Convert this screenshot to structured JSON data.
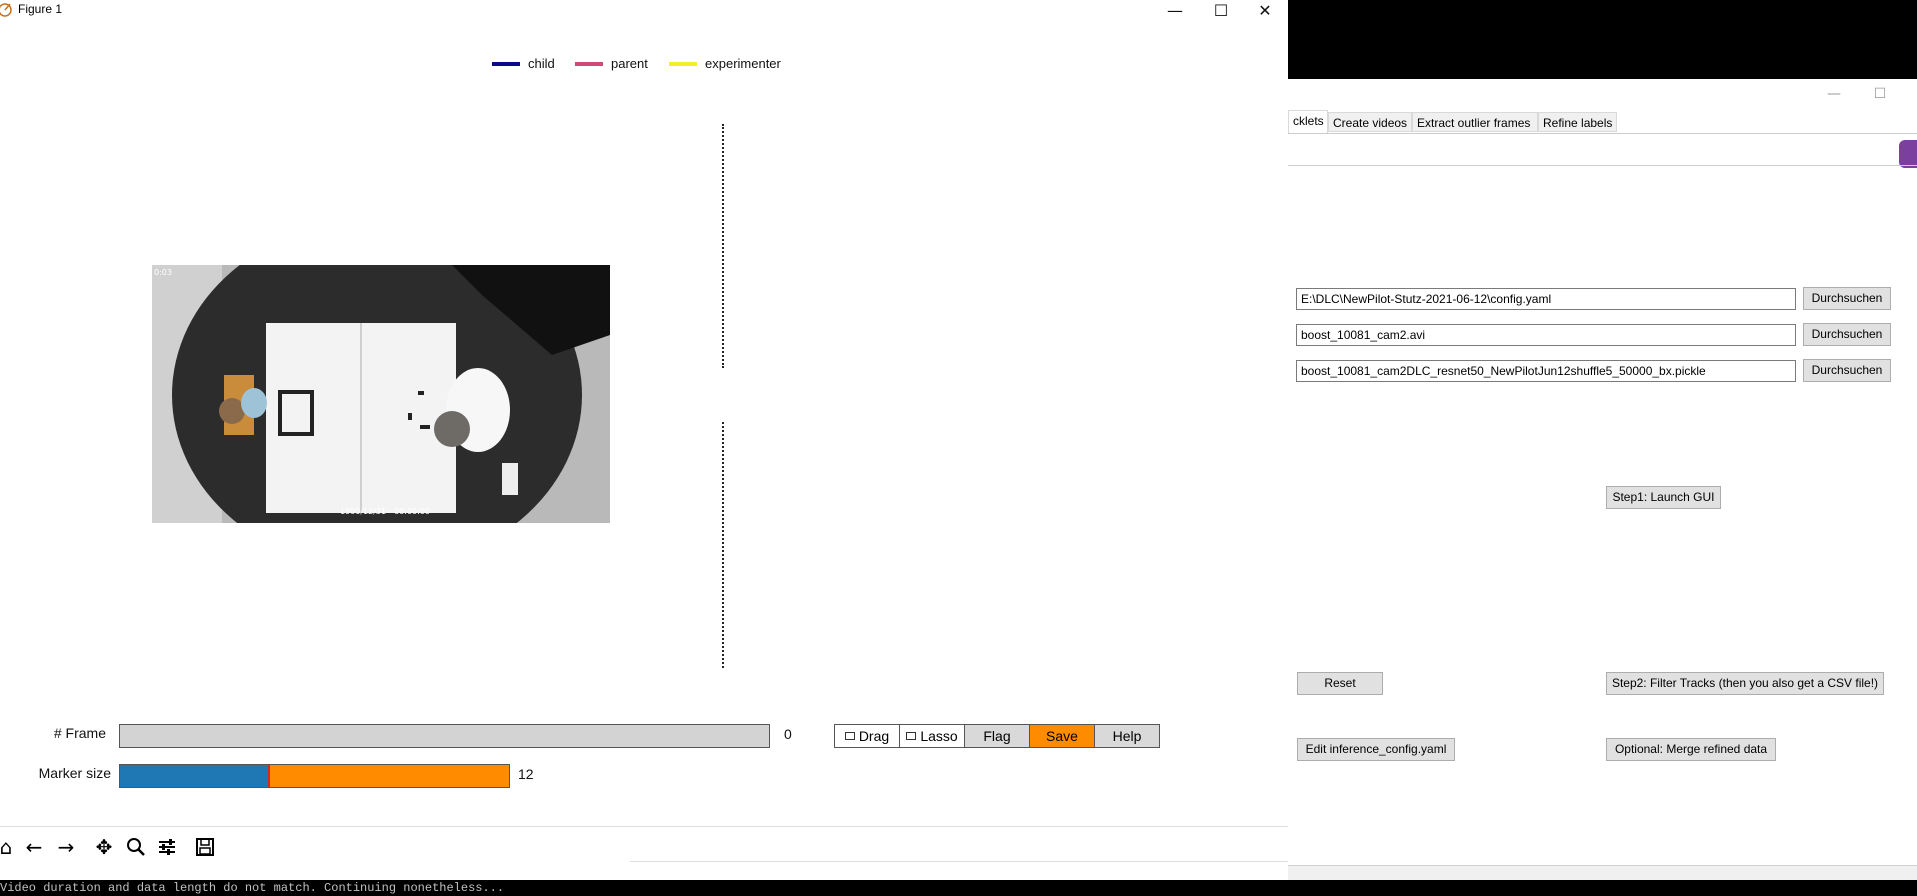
{
  "figure": {
    "window_title": "Figure 1",
    "legend": [
      {
        "label": "child",
        "color": "#0b0b8a"
      },
      {
        "label": "parent",
        "color": "#d04a78"
      },
      {
        "label": "experimenter",
        "color": "#f2ee27"
      }
    ],
    "video_overlay": {
      "top_left": "0:03",
      "bottom_caption": "1900/12/31 - 00:00:00"
    },
    "frame_slider": {
      "label": "# Frame",
      "value": "0"
    },
    "marker_slider": {
      "label": "Marker size",
      "value": "12",
      "fill_fraction": 0.38,
      "fill_color": "#1f77b4",
      "rest_color": "#ff8c00"
    },
    "buttons": {
      "drag": "Drag",
      "lasso": "Lasso",
      "flag": "Flag",
      "save": "Save",
      "help": "Help"
    },
    "save_color": "#ff8c00",
    "toolbar_icons": [
      "home-icon",
      "back-arrow-icon",
      "forward-arrow-icon",
      "pan-icon",
      "zoom-icon",
      "configure-subplots-icon",
      "save-figure-icon"
    ]
  },
  "console": {
    "text": "Video duration and data length do not match. Continuing nonetheless..."
  },
  "dlc": {
    "tabs": [
      "cklets",
      "Create videos",
      "Extract outlier frames",
      "Refine labels"
    ],
    "fields": [
      {
        "value": "E:\\DLC\\NewPilot-Stutz-2021-06-12\\config.yaml",
        "button": "Durchsuchen"
      },
      {
        "value": "boost_10081_cam2.avi",
        "button": "Durchsuchen"
      },
      {
        "value": "boost_10081_cam2DLC_resnet50_NewPilotJun12shuffle5_50000_bx.pickle",
        "button": "Durchsuchen"
      }
    ],
    "buttons": {
      "launch_gui": "Step1: Launch GUI",
      "reset": "Reset",
      "filter_tracks": "Step2: Filter Tracks (then you also get a CSV file!)",
      "edit_inference": "Edit inference_config.yaml",
      "merge": "Optional: Merge refined data"
    }
  }
}
